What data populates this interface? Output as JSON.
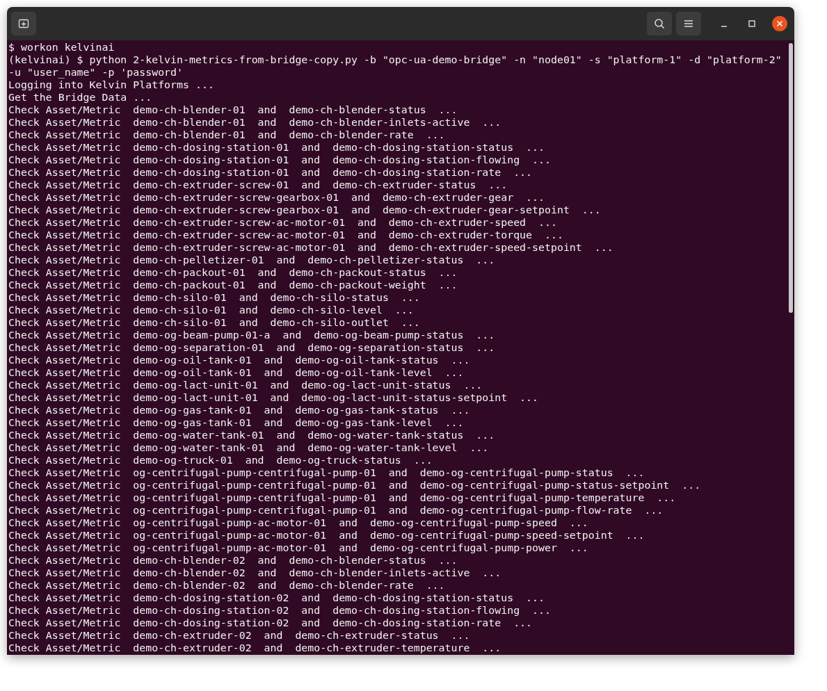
{
  "header": {
    "buttons": [
      {
        "kind": "new-tab"
      },
      {
        "kind": "search"
      },
      {
        "kind": "menu"
      },
      {
        "kind": "minimize"
      },
      {
        "kind": "maximize"
      },
      {
        "kind": "close"
      }
    ]
  },
  "terminal": {
    "lines": [
      "$ workon kelvinai",
      "(kelvinai) $ python 2-kelvin-metrics-from-bridge-copy.py -b \"opc-ua-demo-bridge\" -n \"node01\" -s \"platform-1\" -d \"platform-2\"",
      "-u \"user_name\" -p 'password'",
      "Logging into Kelvin Platforms ...",
      "Get the Bridge Data ...",
      "Check Asset/Metric  demo-ch-blender-01  and  demo-ch-blender-status  ...",
      "Check Asset/Metric  demo-ch-blender-01  and  demo-ch-blender-inlets-active  ...",
      "Check Asset/Metric  demo-ch-blender-01  and  demo-ch-blender-rate  ...",
      "Check Asset/Metric  demo-ch-dosing-station-01  and  demo-ch-dosing-station-status  ...",
      "Check Asset/Metric  demo-ch-dosing-station-01  and  demo-ch-dosing-station-flowing  ...",
      "Check Asset/Metric  demo-ch-dosing-station-01  and  demo-ch-dosing-station-rate  ...",
      "Check Asset/Metric  demo-ch-extruder-screw-01  and  demo-ch-extruder-status  ...",
      "Check Asset/Metric  demo-ch-extruder-screw-gearbox-01  and  demo-ch-extruder-gear  ...",
      "Check Asset/Metric  demo-ch-extruder-screw-gearbox-01  and  demo-ch-extruder-gear-setpoint  ...",
      "Check Asset/Metric  demo-ch-extruder-screw-ac-motor-01  and  demo-ch-extruder-speed  ...",
      "Check Asset/Metric  demo-ch-extruder-screw-ac-motor-01  and  demo-ch-extruder-torque  ...",
      "Check Asset/Metric  demo-ch-extruder-screw-ac-motor-01  and  demo-ch-extruder-speed-setpoint  ...",
      "Check Asset/Metric  demo-ch-pelletizer-01  and  demo-ch-pelletizer-status  ...",
      "Check Asset/Metric  demo-ch-packout-01  and  demo-ch-packout-status  ...",
      "Check Asset/Metric  demo-ch-packout-01  and  demo-ch-packout-weight  ...",
      "Check Asset/Metric  demo-ch-silo-01  and  demo-ch-silo-status  ...",
      "Check Asset/Metric  demo-ch-silo-01  and  demo-ch-silo-level  ...",
      "Check Asset/Metric  demo-ch-silo-01  and  demo-ch-silo-outlet  ...",
      "Check Asset/Metric  demo-og-beam-pump-01-a  and  demo-og-beam-pump-status  ...",
      "Check Asset/Metric  demo-og-separation-01  and  demo-og-separation-status  ...",
      "Check Asset/Metric  demo-og-oil-tank-01  and  demo-og-oil-tank-status  ...",
      "Check Asset/Metric  demo-og-oil-tank-01  and  demo-og-oil-tank-level  ...",
      "Check Asset/Metric  demo-og-lact-unit-01  and  demo-og-lact-unit-status  ...",
      "Check Asset/Metric  demo-og-lact-unit-01  and  demo-og-lact-unit-status-setpoint  ...",
      "Check Asset/Metric  demo-og-gas-tank-01  and  demo-og-gas-tank-status  ...",
      "Check Asset/Metric  demo-og-gas-tank-01  and  demo-og-gas-tank-level  ...",
      "Check Asset/Metric  demo-og-water-tank-01  and  demo-og-water-tank-status  ...",
      "Check Asset/Metric  demo-og-water-tank-01  and  demo-og-water-tank-level  ...",
      "Check Asset/Metric  demo-og-truck-01  and  demo-og-truck-status  ...",
      "Check Asset/Metric  og-centrifugal-pump-centrifugal-pump-01  and  demo-og-centrifugal-pump-status  ...",
      "Check Asset/Metric  og-centrifugal-pump-centrifugal-pump-01  and  demo-og-centrifugal-pump-status-setpoint  ...",
      "Check Asset/Metric  og-centrifugal-pump-centrifugal-pump-01  and  demo-og-centrifugal-pump-temperature  ...",
      "Check Asset/Metric  og-centrifugal-pump-centrifugal-pump-01  and  demo-og-centrifugal-pump-flow-rate  ...",
      "Check Asset/Metric  og-centrifugal-pump-ac-motor-01  and  demo-og-centrifugal-pump-speed  ...",
      "Check Asset/Metric  og-centrifugal-pump-ac-motor-01  and  demo-og-centrifugal-pump-speed-setpoint  ...",
      "Check Asset/Metric  og-centrifugal-pump-ac-motor-01  and  demo-og-centrifugal-pump-power  ...",
      "Check Asset/Metric  demo-ch-blender-02  and  demo-ch-blender-status  ...",
      "Check Asset/Metric  demo-ch-blender-02  and  demo-ch-blender-inlets-active  ...",
      "Check Asset/Metric  demo-ch-blender-02  and  demo-ch-blender-rate  ...",
      "Check Asset/Metric  demo-ch-dosing-station-02  and  demo-ch-dosing-station-status  ...",
      "Check Asset/Metric  demo-ch-dosing-station-02  and  demo-ch-dosing-station-flowing  ...",
      "Check Asset/Metric  demo-ch-dosing-station-02  and  demo-ch-dosing-station-rate  ...",
      "Check Asset/Metric  demo-ch-extruder-02  and  demo-ch-extruder-status  ...",
      "Check Asset/Metric  demo-ch-extruder-02  and  demo-ch-extruder-temperature  ..."
    ]
  }
}
